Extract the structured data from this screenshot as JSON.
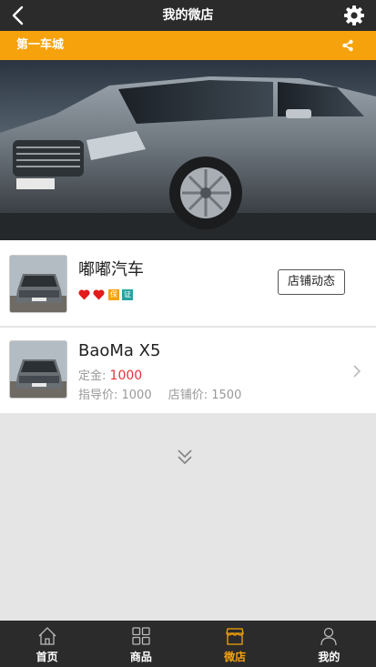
{
  "header": {
    "title": "我的微店",
    "back_icon": "back-arrow-icon",
    "settings_icon": "gear-icon"
  },
  "shop_bar": {
    "name": "第一车城",
    "share_icon": "share-icon",
    "color": "#f6a20c"
  },
  "banner": {
    "image": "car-banner-image"
  },
  "shop": {
    "title": "嘟嘟汽车",
    "hearts": 2,
    "badge_bao": "保",
    "badge_zheng": "证",
    "news_button": "店铺动态"
  },
  "product": {
    "name": "BaoMa X5",
    "deposit_label": "定金:",
    "deposit_value": "1000",
    "guide_price": "指导价: 1000",
    "shop_price": "店铺价: 1500"
  },
  "more_icon": "double-chevron-down-icon",
  "tabs": [
    {
      "label": "首页",
      "icon": "home-icon",
      "active": false
    },
    {
      "label": "商品",
      "icon": "grid-icon",
      "active": false
    },
    {
      "label": "微店",
      "icon": "shop-icon",
      "active": true
    },
    {
      "label": "我的",
      "icon": "user-icon",
      "active": false
    }
  ],
  "colors": {
    "accent": "#f6a20c",
    "price_red": "#e8323a",
    "dark_bar": "#2b2b2b"
  }
}
